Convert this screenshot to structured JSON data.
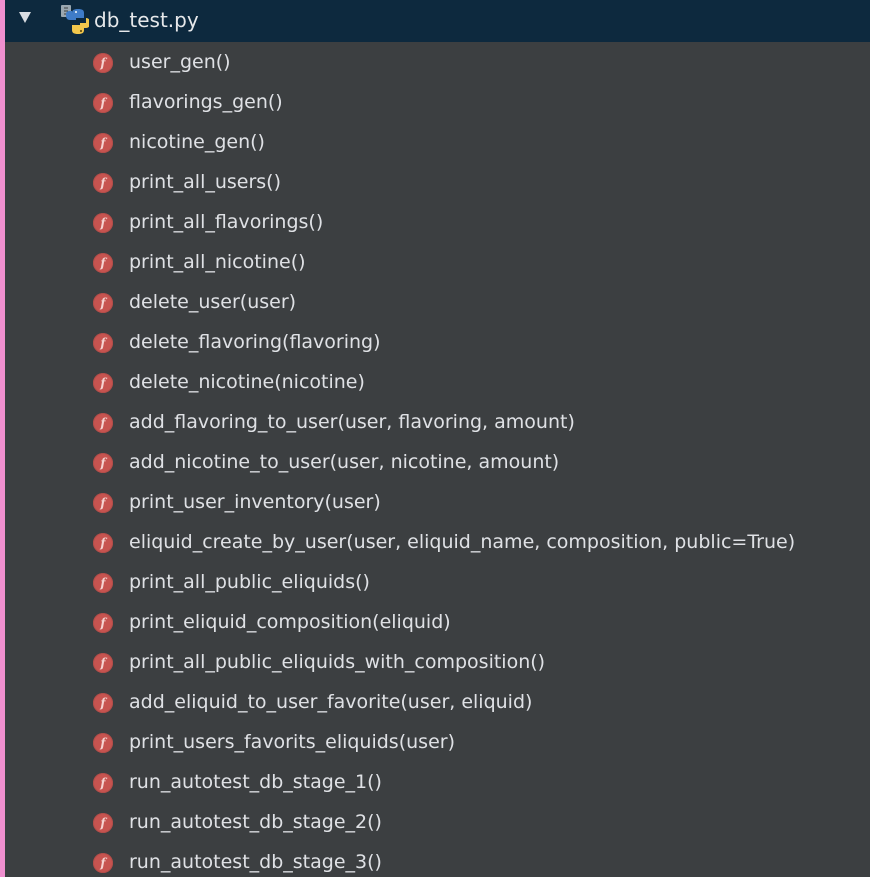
{
  "file": {
    "name": "db_test.py",
    "expanded": true
  },
  "functions": [
    {
      "label": "user_gen()"
    },
    {
      "label": "flavorings_gen()"
    },
    {
      "label": "nicotine_gen()"
    },
    {
      "label": "print_all_users()"
    },
    {
      "label": "print_all_flavorings()"
    },
    {
      "label": "print_all_nicotine()"
    },
    {
      "label": "delete_user(user)"
    },
    {
      "label": "delete_flavoring(flavoring)"
    },
    {
      "label": "delete_nicotine(nicotine)"
    },
    {
      "label": "add_flavoring_to_user(user, flavoring, amount)"
    },
    {
      "label": "add_nicotine_to_user(user, nicotine, amount)"
    },
    {
      "label": "print_user_inventory(user)"
    },
    {
      "label": "eliquid_create_by_user(user, eliquid_name, composition, public=True)"
    },
    {
      "label": "print_all_public_eliquids()"
    },
    {
      "label": "print_eliquid_composition(eliquid)"
    },
    {
      "label": "print_all_public_eliquids_with_composition()"
    },
    {
      "label": "add_eliquid_to_user_favorite(user, eliquid)"
    },
    {
      "label": "print_users_favorits_eliquids(user)"
    },
    {
      "label": "run_autotest_db_stage_1()"
    },
    {
      "label": "run_autotest_db_stage_2()"
    },
    {
      "label": "run_autotest_db_stage_3()"
    }
  ],
  "function_icon_glyph": "f",
  "icon_names": {
    "expand": "chevron-down-icon",
    "file": "python-file-icon",
    "function": "function-icon"
  },
  "colors": {
    "panel_background": "#3c3f41",
    "selected_row": "#0d293e",
    "function_icon": "#c75450",
    "text": "#dfe1e5",
    "left_strip": "#ef8fcf"
  }
}
